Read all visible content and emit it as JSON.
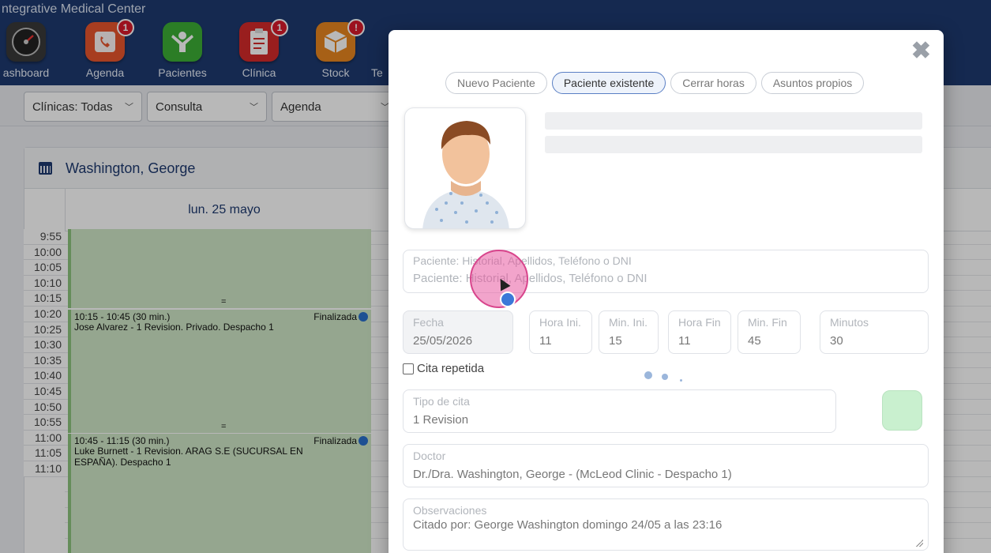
{
  "app": {
    "title": "ntegrative Medical Center"
  },
  "nav": [
    {
      "label": "ashboard",
      "icon": "speedometer-icon",
      "color": "#3a3a3a",
      "badge": ""
    },
    {
      "label": "Agenda",
      "icon": "phone-icon",
      "color": "#e8552d",
      "badge": "1"
    },
    {
      "label": "Pacientes",
      "icon": "patient-icon",
      "color": "#3cae35",
      "badge": ""
    },
    {
      "label": "Clínica",
      "icon": "clipboard-icon",
      "color": "#d42a2a",
      "badge": "1"
    },
    {
      "label": "Stock",
      "icon": "box-icon",
      "color": "#e8861f",
      "badge": "!"
    },
    {
      "label": "Te",
      "icon": "generic-icon",
      "color": "#3cae35",
      "badge": ""
    }
  ],
  "filters": {
    "clinicas": "Clínicas: Todas",
    "consulta": "Consulta",
    "agenda": "Agenda"
  },
  "calendar": {
    "doctor": "Washington, George",
    "day": "lun. 25 mayo",
    "times": [
      "9:55",
      "10:00",
      "10:05",
      "10:10",
      "10:15",
      "10:20",
      "10:25",
      "10:30",
      "10:35",
      "10:40",
      "10:45",
      "10:50",
      "10:55",
      "11:00",
      "11:05",
      "11:10"
    ],
    "appointments": [
      {
        "time": "",
        "status": "",
        "desc": "",
        "eq": "="
      },
      {
        "time": "10:15 - 10:45 (30 min.)",
        "status": "Finalizada",
        "desc": "Jose Alvarez - 1 Revision. Privado. Despacho 1",
        "eq": "="
      },
      {
        "time": "10:45 - 11:15 (30 min.)",
        "status": "Finalizada",
        "desc": "Luke Burnett - 1 Revision. ARAG S.E (SUCURSAL EN ESPAÑA). Despacho 1",
        "eq": ""
      }
    ]
  },
  "modal": {
    "close": "✖",
    "tabs": [
      "Nuevo Paciente",
      "Paciente existente",
      "Cerrar horas",
      "Asuntos propios"
    ],
    "active_tab": "Paciente existente",
    "search": {
      "label": "Paciente: Historial, Apellidos, Teléfono o DNI",
      "placeholder": "Paciente: Historial, Apellidos, Teléfono o DNI"
    },
    "fecha": {
      "label": "Fecha",
      "value": "25/05/2026"
    },
    "hora_ini": {
      "label": "Hora Ini.",
      "value": "11"
    },
    "min_ini": {
      "label": "Min. Ini.",
      "value": "15"
    },
    "hora_fin": {
      "label": "Hora Fin",
      "value": "11"
    },
    "min_fin": {
      "label": "Min. Fin",
      "value": "45"
    },
    "minutos": {
      "label": "Minutos",
      "value": "30"
    },
    "cita_repetida": "Cita repetida",
    "tipo_cita": {
      "label": "Tipo de cita",
      "value": "1 Revision"
    },
    "doctor": {
      "label": "Doctor",
      "value": "Dr./Dra. Washington, George - (McLeod Clinic - Despacho 1)"
    },
    "observaciones": {
      "label": "Observaciones",
      "value": "Citado por: George Washington domingo 24/05 a las 23:16"
    },
    "tipo_color": "#c9f0cf"
  }
}
